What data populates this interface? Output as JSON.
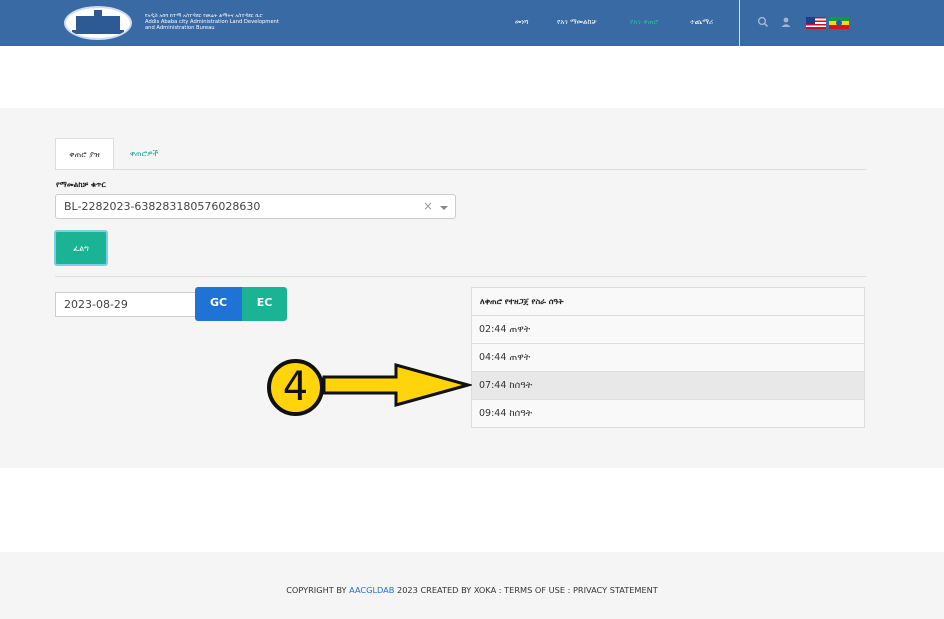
{
  "header": {
    "org_lines": [
      "የአዲስ አበባ ከተማ አስተዳደር የመሬት ልማትና አስተዳደር ቢሮ",
      "Addis Ababa city Administration Land Development",
      "and Administration Bureau"
    ],
    "nav": [
      "መነሻ",
      "የአገ ማመልከቻ",
      "የአገ ቀጠሮ",
      "ተጨማሪ"
    ],
    "active_nav_index": 2,
    "accent_color": "#1fc1a0",
    "icons": [
      "search-icon",
      "user-icon",
      "us-flag-icon",
      "ethiopia-flag-icon"
    ]
  },
  "tabs": [
    "ቀጠሮ ያዝ",
    "ቀጠሮዎች"
  ],
  "form": {
    "field_label": "የማመልከቻ ቁጥር",
    "application_number": "BL-2282023-638283180576028630",
    "clear_symbol": "×",
    "search_button": "ፈልግ"
  },
  "date": {
    "value": "2023-08-29",
    "gc_label": "GC",
    "ec_label": "EC"
  },
  "timelist": {
    "header": "ለቀጠሮ የተዘጋጀ የስራ ሰዓት",
    "slots": [
      "02:44 ጠዋት",
      "04:44 ጠዋት",
      "07:44 ከሰዓት",
      "09:44 ከሰዓት"
    ],
    "highlighted_index": 2
  },
  "annotation": {
    "number": "4",
    "color": "#ffd40a"
  },
  "footer": {
    "prefix": "COPYRIGHT BY ",
    "link": "AACGLDAB",
    "suffix": " 2023 CREATED BY XOKA : TERMS OF USE : PRIVACY STATEMENT"
  }
}
